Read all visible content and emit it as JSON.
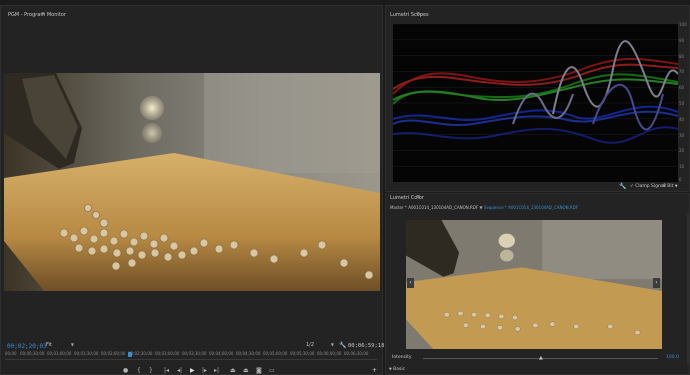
{
  "program_monitor": {
    "tab_label": "PGM - Program Monitor",
    "timecode_current": "00;02;20;03",
    "zoom_label": "Fit",
    "resolution_label": "1/2",
    "timecode_duration": "00;06;59;18",
    "ruler_ticks": [
      "00;00",
      "00;00;30;00",
      "00;01;00;00",
      "00;01;30;00",
      "00;02;00;00",
      "00;02;30;00",
      "00;03;00;00",
      "00;03;30;00",
      "00;04;00;00",
      "00;04;30;00",
      "00;05;00;00",
      "00;05;30;00",
      "00;06;00;00",
      "00;06;30;00"
    ],
    "playhead_fraction": 0.335
  },
  "scopes_panel": {
    "tab_label": "Lumetri Scopes",
    "scale_labels": [
      "100",
      "90",
      "80",
      "70",
      "60",
      "50",
      "40",
      "30",
      "20",
      "10",
      "0"
    ],
    "footer_label": "Clamp Signal",
    "footer_bits": "8 Bit"
  },
  "color_panel": {
    "tab_label": "Lumetri Color",
    "source_label": "Master * A001C014_130104AD_CANON.RDF",
    "sequence_label": "Sequence * A001C014_130104AD_CANON.RDF",
    "intensity_label": "Intensity",
    "intensity_value": "100.0",
    "section_label": "Basic"
  },
  "colors": {
    "accent": "#3a8fd8",
    "panel_bg": "#232323",
    "app_bg": "#1b1b1b"
  }
}
